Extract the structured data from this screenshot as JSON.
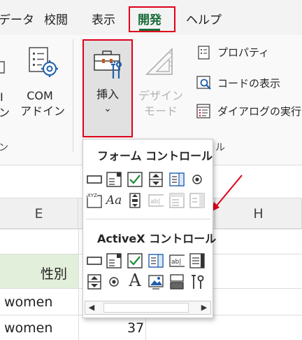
{
  "tabs": [
    {
      "label": "データ"
    },
    {
      "label": "校閲"
    },
    {
      "label": "表示"
    },
    {
      "label": "開発"
    },
    {
      "label": "ヘルプ"
    }
  ],
  "ribbon": {
    "addin_partial_1": "I",
    "addin_partial_2": "ン",
    "com_addin_line1": "COM",
    "com_addin_line2": "アドイン",
    "insert_label": "挿入",
    "insert_chevron": "⌄",
    "design_mode_line1": "デザイン",
    "design_mode_line2": "モード",
    "properties_label": "プロパティ",
    "view_code_label": "コードの表示",
    "dialog_label": "ダイアログの実行",
    "group_partial_left": "ン",
    "group_partial_right": "ル"
  },
  "dropdown": {
    "form_controls_title": "フォーム コントロール",
    "activex_controls_title": "ActiveX コントロール",
    "label_control_text": "Aa",
    "groupbox_text": "XYZ",
    "abl_text": "ab|",
    "activex_label_text": "A",
    "scroll_left": "◀",
    "scroll_right": "▶"
  },
  "sheet": {
    "columns": [
      {
        "label": "E"
      },
      {
        "label": "H"
      }
    ],
    "header_cell": "性別",
    "rows": [
      {
        "e": "women",
        "f": ""
      },
      {
        "e": "women",
        "f": "37"
      }
    ]
  },
  "colors": {
    "active_tab": "#1a6d3a",
    "highlight_box": "#e0001b",
    "header_fill": "#e2efda",
    "checkbox_green": "#1e8c3a",
    "control_blue": "#1f5fae"
  }
}
